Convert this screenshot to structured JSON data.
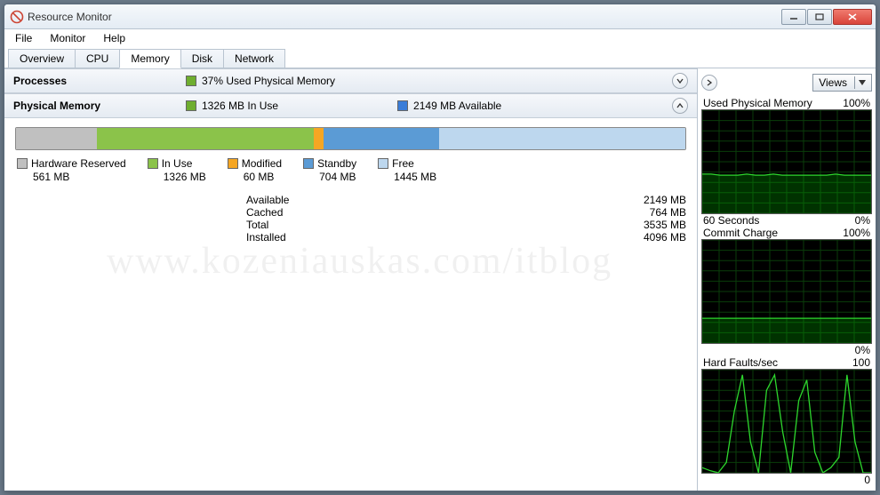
{
  "titlebar": {
    "title": "Resource Monitor"
  },
  "menu": {
    "items": [
      "File",
      "Monitor",
      "Help"
    ]
  },
  "tabs": {
    "items": [
      "Overview",
      "CPU",
      "Memory",
      "Disk",
      "Network"
    ],
    "active": 2
  },
  "processes": {
    "title": "Processes",
    "summary": "37% Used Physical Memory",
    "color": "#6fae2f"
  },
  "physical": {
    "title": "Physical Memory",
    "inuse_label": "1326 MB In Use",
    "avail_label": "2149 MB Available",
    "inuse_color": "#6fae2f",
    "avail_color": "#3b7dd8",
    "segments": [
      {
        "label": "Hardware Reserved",
        "value": "561 MB",
        "color": "#c0c0c0",
        "width": 12.1
      },
      {
        "label": "In Use",
        "value": "1326 MB",
        "color": "#8bc34a",
        "width": 32.4
      },
      {
        "label": "Modified",
        "value": "60 MB",
        "color": "#f5a623",
        "width": 1.5
      },
      {
        "label": "Standby",
        "value": "704 MB",
        "color": "#5b9bd5",
        "width": 17.2
      },
      {
        "label": "Free",
        "value": "1445 MB",
        "color": "#bdd7ee",
        "width": 36.8
      }
    ],
    "stats": [
      {
        "label": "Available",
        "value": "2149 MB"
      },
      {
        "label": "Cached",
        "value": "764 MB"
      },
      {
        "label": "Total",
        "value": "3535 MB"
      },
      {
        "label": "Installed",
        "value": "4096 MB"
      }
    ]
  },
  "right": {
    "views_label": "Views",
    "graphs": [
      {
        "title": "Used Physical Memory",
        "max": "100%",
        "footer_left": "60 Seconds",
        "footer_right": "0%"
      },
      {
        "title": "Commit Charge",
        "max": "100%",
        "footer_left": "",
        "footer_right": "0%"
      },
      {
        "title": "Hard Faults/sec",
        "max": "100",
        "footer_left": "",
        "footer_right": "0"
      }
    ]
  },
  "chart_data": [
    {
      "type": "area",
      "title": "Used Physical Memory",
      "ylim": [
        0,
        100
      ],
      "x": "60 Seconds",
      "values": [
        38,
        38,
        37,
        37,
        37,
        38,
        37,
        37,
        38,
        37,
        37,
        37,
        37,
        37,
        37,
        38,
        37,
        37,
        37,
        37
      ]
    },
    {
      "type": "area",
      "title": "Commit Charge",
      "ylim": [
        0,
        100
      ],
      "x": "60 Seconds",
      "values": [
        24,
        24,
        24,
        24,
        24,
        24,
        24,
        24,
        24,
        24,
        24,
        24,
        24,
        24,
        24,
        24,
        24,
        24,
        24,
        24
      ]
    },
    {
      "type": "line",
      "title": "Hard Faults/sec",
      "ylim": [
        0,
        100
      ],
      "x": "60 Seconds",
      "values": [
        5,
        2,
        0,
        10,
        60,
        95,
        30,
        0,
        80,
        95,
        40,
        0,
        70,
        90,
        20,
        0,
        5,
        15,
        95,
        30,
        0,
        0
      ]
    }
  ],
  "watermark": "www.kozeniauskas.com/itblog"
}
